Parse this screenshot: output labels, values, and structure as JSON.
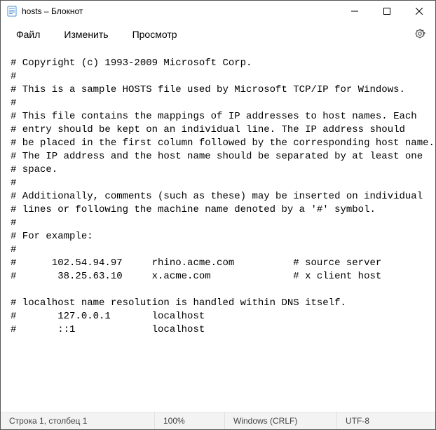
{
  "titlebar": {
    "title": "hosts – Блокнот"
  },
  "menubar": {
    "file": "Файл",
    "edit": "Изменить",
    "view": "Просмотр"
  },
  "editor": {
    "content": "# Copyright (c) 1993-2009 Microsoft Corp.\n#\n# This is a sample HOSTS file used by Microsoft TCP/IP for Windows.\n#\n# This file contains the mappings of IP addresses to host names. Each\n# entry should be kept on an individual line. The IP address should\n# be placed in the first column followed by the corresponding host name.\n# The IP address and the host name should be separated by at least one\n# space.\n#\n# Additionally, comments (such as these) may be inserted on individual\n# lines or following the machine name denoted by a '#' symbol.\n#\n# For example:\n#\n#      102.54.94.97     rhino.acme.com          # source server\n#       38.25.63.10     x.acme.com              # x client host\n\n# localhost name resolution is handled within DNS itself.\n#\t127.0.0.1       localhost\n#\t::1             localhost"
  },
  "statusbar": {
    "position": "Строка 1, столбец 1",
    "zoom": "100%",
    "line_ending": "Windows (CRLF)",
    "encoding": "UTF-8"
  }
}
